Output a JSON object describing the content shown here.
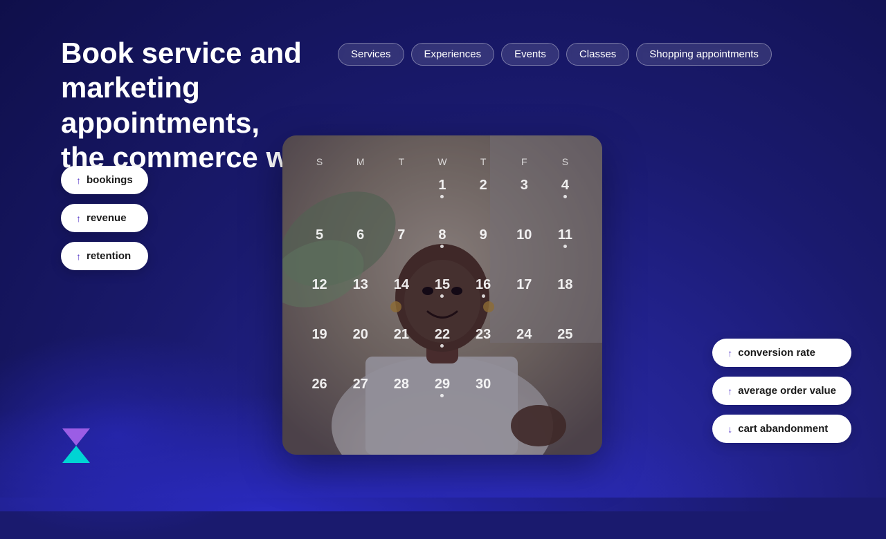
{
  "headline": {
    "line1": "Book service and marketing appointments,",
    "line2": "the commerce way!"
  },
  "tags": [
    {
      "id": "services",
      "label": "Services"
    },
    {
      "id": "experiences",
      "label": "Experiences"
    },
    {
      "id": "events",
      "label": "Events"
    },
    {
      "id": "classes",
      "label": "Classes"
    },
    {
      "id": "shopping",
      "label": "Shopping appointments"
    }
  ],
  "left_metrics": [
    {
      "id": "bookings",
      "label": "bookings",
      "arrow": "up"
    },
    {
      "id": "revenue",
      "label": "revenue",
      "arrow": "up"
    },
    {
      "id": "retention",
      "label": "retention",
      "arrow": "up"
    }
  ],
  "right_metrics": [
    {
      "id": "conversion",
      "label": "conversion rate",
      "arrow": "up"
    },
    {
      "id": "aov",
      "label": "average order value",
      "arrow": "up"
    },
    {
      "id": "cart",
      "label": "cart abandonment",
      "arrow": "down"
    }
  ],
  "calendar": {
    "day_names": [
      "S",
      "M",
      "T",
      "W",
      "T",
      "F",
      "S"
    ],
    "weeks": [
      [
        {
          "num": "",
          "dot": false
        },
        {
          "num": "",
          "dot": false
        },
        {
          "num": "",
          "dot": false
        },
        {
          "num": "1",
          "dot": true
        },
        {
          "num": "2",
          "dot": false
        },
        {
          "num": "3",
          "dot": false
        },
        {
          "num": "4",
          "dot": true
        }
      ],
      [
        {
          "num": "5",
          "dot": false
        },
        {
          "num": "6",
          "dot": false
        },
        {
          "num": "7",
          "dot": false
        },
        {
          "num": "8",
          "dot": true
        },
        {
          "num": "9",
          "dot": false
        },
        {
          "num": "10",
          "dot": false
        },
        {
          "num": "11",
          "dot": true
        }
      ],
      [
        {
          "num": "12",
          "dot": false
        },
        {
          "num": "13",
          "dot": false
        },
        {
          "num": "14",
          "dot": false
        },
        {
          "num": "15",
          "dot": true
        },
        {
          "num": "16",
          "dot": true
        },
        {
          "num": "17",
          "dot": false
        },
        {
          "num": "18",
          "dot": false
        }
      ],
      [
        {
          "num": "19",
          "dot": false
        },
        {
          "num": "20",
          "dot": false
        },
        {
          "num": "21",
          "dot": false
        },
        {
          "num": "22",
          "dot": true
        },
        {
          "num": "23",
          "dot": false
        },
        {
          "num": "24",
          "dot": false
        },
        {
          "num": "25",
          "dot": false
        }
      ],
      [
        {
          "num": "26",
          "dot": false
        },
        {
          "num": "27",
          "dot": false
        },
        {
          "num": "28",
          "dot": false
        },
        {
          "num": "29",
          "dot": true
        },
        {
          "num": "30",
          "dot": false
        },
        {
          "num": "",
          "dot": false
        },
        {
          "num": "",
          "dot": false
        }
      ]
    ]
  },
  "logo": {
    "alt": "Brand logo hourglass"
  },
  "colors": {
    "bg_dark": "#1a1a6e",
    "bg_medium": "#2323a0",
    "accent_purple": "#5b3ec8",
    "white": "#ffffff",
    "pill_bg": "#ffffff"
  }
}
